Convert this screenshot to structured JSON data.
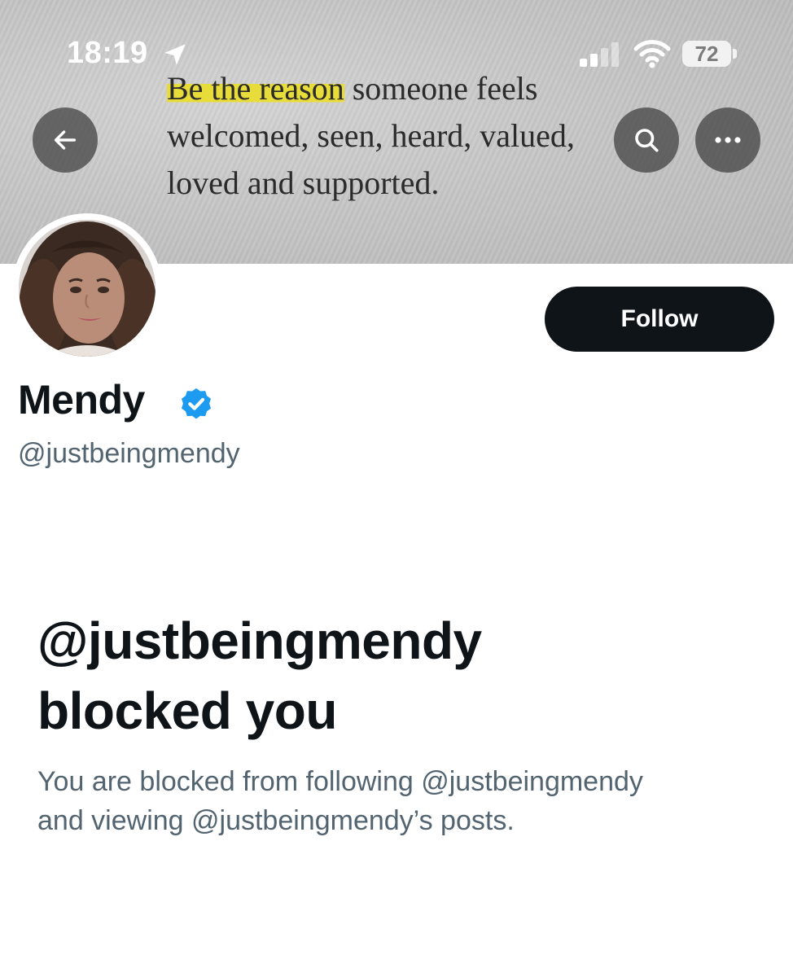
{
  "status_bar": {
    "time": "18:19",
    "battery": "72",
    "icons": [
      "location-arrow-icon",
      "signal-icon",
      "wifi-icon",
      "battery-icon"
    ]
  },
  "banner": {
    "quote_highlight": "Be the reason",
    "quote_line1_rest": " someone feels",
    "quote_line2": "welcomed, seen, heard, valued,",
    "quote_line3": "loved and supported.",
    "highlight_color": "#e8dc3a"
  },
  "nav": {
    "icons": [
      "back-arrow-icon",
      "search-icon",
      "more-icon"
    ]
  },
  "profile": {
    "name": "Mendy",
    "handle": "@justbeingmendy",
    "follow_label": "Follow",
    "verified_color": "#1d9bf0"
  },
  "blocked": {
    "title_line1": "@justbeingmendy",
    "title_line2": "blocked you",
    "description_line1": "You are blocked from following @justbeingmendy",
    "description_line2": "and viewing @justbeingmendy’s posts."
  }
}
